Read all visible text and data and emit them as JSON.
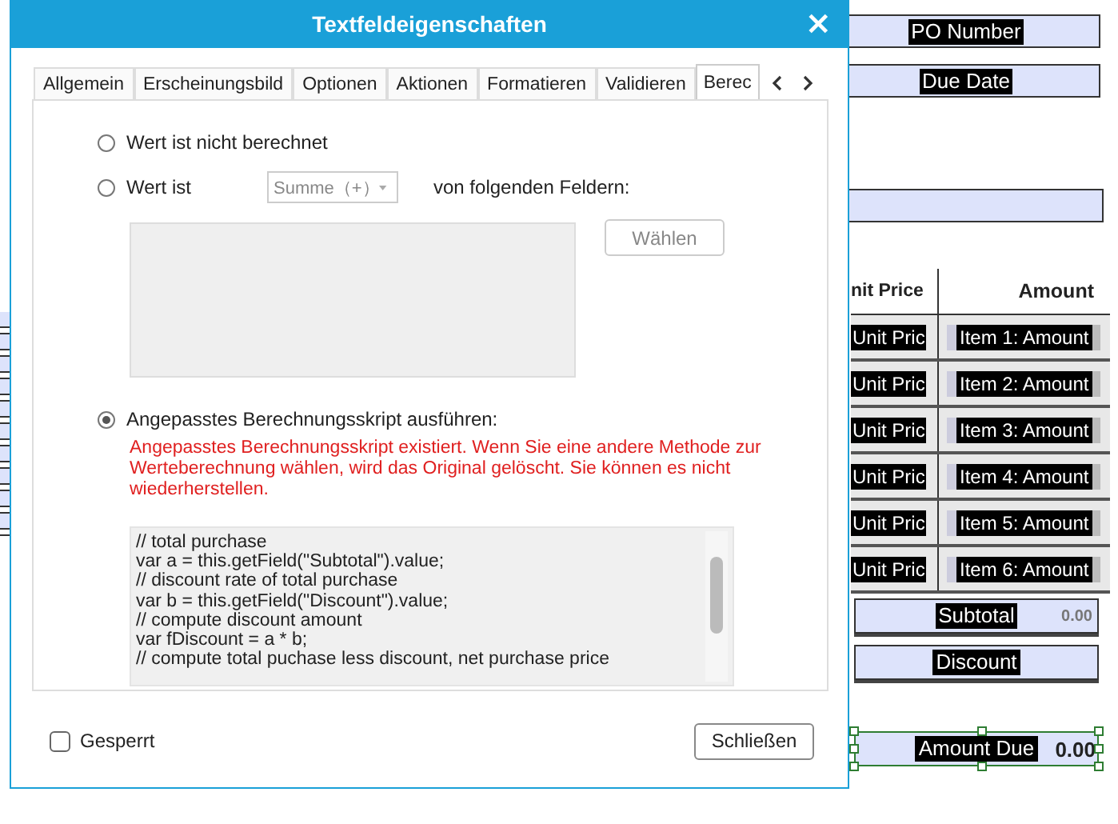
{
  "document": {
    "po_number": "PO Number",
    "due_date": "Due Date",
    "columns": [
      "nit Price",
      "Amount"
    ],
    "rows": [
      {
        "price": "Unit Pric",
        "amount": "Item 1: Amount"
      },
      {
        "price": "Unit Pric",
        "amount": "Item 2: Amount"
      },
      {
        "price": "Unit Pric",
        "amount": "Item 3: Amount"
      },
      {
        "price": "Unit Pric",
        "amount": "Item 4: Amount"
      },
      {
        "price": "Unit Pric",
        "amount": "Item 5: Amount"
      },
      {
        "price": "Unit Pric",
        "amount": "Item 6: Amount"
      }
    ],
    "subtotal": {
      "label": "Subtotal",
      "value": "0.00"
    },
    "discount": {
      "label": "Discount"
    },
    "amount_due": {
      "label": "Amount Due",
      "value": "0.00",
      "selected": true
    }
  },
  "dialog": {
    "title": "Textfeldeigenschaften",
    "close": "×",
    "tabs": [
      {
        "label": "Allgemein",
        "selected": false
      },
      {
        "label": "Erscheinungsbild",
        "selected": false
      },
      {
        "label": "Optionen",
        "selected": false
      },
      {
        "label": "Aktionen",
        "selected": false
      },
      {
        "label": "Formatieren",
        "selected": false
      },
      {
        "label": "Validieren",
        "selected": false
      },
      {
        "label": "Berec",
        "selected": true
      }
    ],
    "options": [
      {
        "kind": "plain",
        "label": "Wert ist nicht berechnet",
        "selected": false
      },
      {
        "kind": "sum",
        "label": "Wert ist",
        "selected": false,
        "disabled": true,
        "dropdown": "Summe（+）",
        "suffix": "von folgenden Feldern:",
        "button": "Wählen"
      },
      {
        "kind": "script",
        "label": "Angepasstes Berechnungsskript ausführen:",
        "selected": true,
        "warning": "Angepasstes Berechnungsskript existiert. Wenn Sie eine andere Methode zur Werteberechnung wählen, wird das Original gelöscht. Sie können es nicht wiederherstellen.",
        "script": [
          "// total purchase",
          "var a = this.getField(\"Subtotal\").value;",
          "// discount rate of total purchase",
          "var b = this.getField(\"Discount\").value;",
          "// compute discount amount",
          "var fDiscount = a * b;",
          "// compute total puchase less discount, net purchase price"
        ]
      }
    ],
    "locked": {
      "label": "Gesperrt",
      "checked": false
    },
    "close_button": "Schließen"
  }
}
